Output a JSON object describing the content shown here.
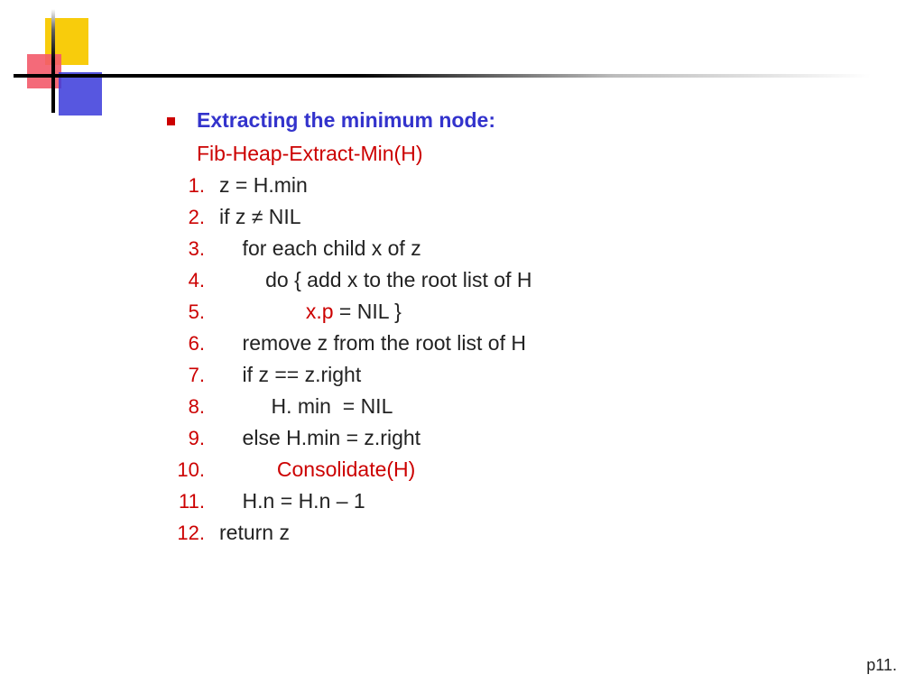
{
  "heading": "Extracting the minimum node:",
  "subheading": "Fib-Heap-Extract-Min(H)",
  "lines": {
    "l1": {
      "n": "1.",
      "t": "z = H.min"
    },
    "l2a": {
      "n": "2.",
      "t": "if z "
    },
    "l2b": "≠",
    "l2c": " NIL",
    "l3": {
      "n": "3.",
      "t": "    for each child x of z"
    },
    "l4": {
      "n": "4.",
      "t": "        do { add x to the root list of H"
    },
    "l5a": {
      "n": "5.",
      "t": "               "
    },
    "l5b": "x.p",
    "l5c": " = NIL }",
    "l6": {
      "n": "6.",
      "t": "    remove z from the root list of H"
    },
    "l7": {
      "n": "7.",
      "t": "    if z == z.right"
    },
    "l8": {
      "n": "8.",
      "t": "         H. min  = NIL"
    },
    "l9": {
      "n": "9.",
      "t": "    else H.min = z.right"
    },
    "l10a": {
      "n": "10.",
      "t": "          "
    },
    "l10b": "Consolidate(H)",
    "l11": {
      "n": "11.",
      "t": "    H.n = H.n – 1"
    },
    "l12": {
      "n": "12.",
      "t": "return z"
    }
  },
  "footer": "p11."
}
